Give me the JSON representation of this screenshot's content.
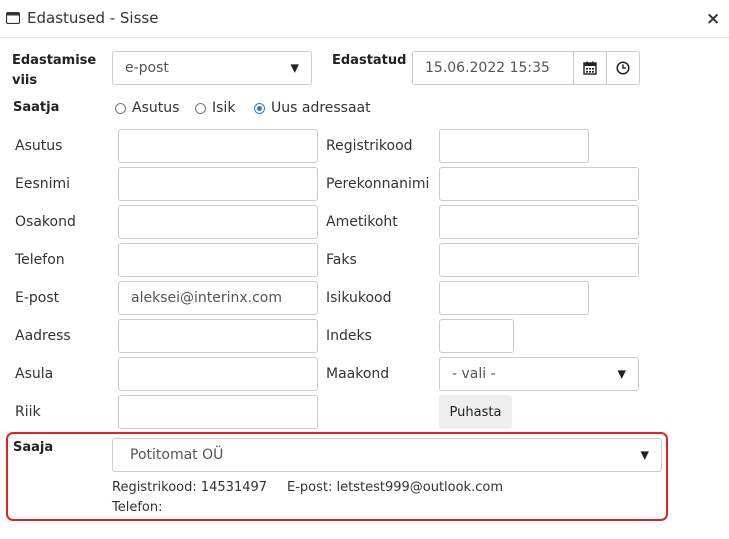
{
  "window": {
    "title": "Edastused - Sisse",
    "close_label": "×"
  },
  "form": {
    "edastamise_viis": {
      "label": "Edastamise viis",
      "value": "e-post"
    },
    "edastatud": {
      "label": "Edastatud",
      "value": "15.06.2022 15:35"
    },
    "saatja": {
      "label": "Saatja",
      "options": [
        "Asutus",
        "Isik",
        "Uus adressaat"
      ],
      "selected": "Uus adressaat"
    },
    "fields": {
      "asutus": {
        "label": "Asutus",
        "value": ""
      },
      "registrikood": {
        "label": "Registrikood",
        "value": ""
      },
      "eesnimi": {
        "label": "Eesnimi",
        "value": ""
      },
      "perekonnanimi": {
        "label": "Perekonnanimi",
        "value": ""
      },
      "osakond": {
        "label": "Osakond",
        "value": ""
      },
      "ametikoht": {
        "label": "Ametikoht",
        "value": ""
      },
      "telefon": {
        "label": "Telefon",
        "value": ""
      },
      "faks": {
        "label": "Faks",
        "value": ""
      },
      "epost": {
        "label": "E-post",
        "value": "aleksei@interinx.com"
      },
      "isikukood": {
        "label": "Isikukood",
        "value": ""
      },
      "aadress": {
        "label": "Aadress",
        "value": ""
      },
      "indeks": {
        "label": "Indeks",
        "value": ""
      },
      "asula": {
        "label": "Asula",
        "value": ""
      },
      "maakond": {
        "label": "Maakond",
        "value": "- vali -"
      },
      "riik": {
        "label": "Riik",
        "value": ""
      }
    },
    "puhasta_label": "Puhasta",
    "saaja": {
      "label": "Saaja",
      "value": "Potitomat OÜ",
      "registrikood": "Registrikood: 14531497",
      "epost": "E-post: letstest999@outlook.com",
      "telefon": "Telefon:"
    }
  },
  "colors": {
    "highlight_border": "#e02424",
    "radio_accent": "#3574d1"
  }
}
